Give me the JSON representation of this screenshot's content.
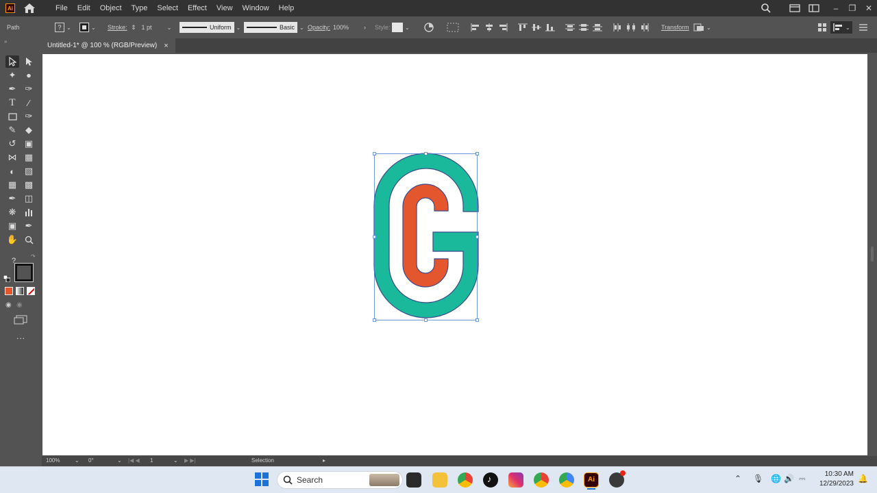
{
  "app": {
    "logo_text": "Ai",
    "menu": [
      "File",
      "Edit",
      "Object",
      "Type",
      "Select",
      "Effect",
      "View",
      "Window",
      "Help"
    ]
  },
  "control_bar": {
    "selection_label": "Path",
    "stroke_label": "Stroke:",
    "stroke_weight": "1 pt",
    "profile_label": "Uniform",
    "brush_label": "Basic",
    "opacity_label": "Opacity:",
    "opacity_value": "100%",
    "style_label": "Style:",
    "transform_label": "Transform"
  },
  "document_tab": {
    "title": "Untitled-1* @ 100 % (RGB/Preview)",
    "close": "×"
  },
  "tools": {
    "fill_unknown": "?",
    "more": "..."
  },
  "artwork": {
    "outer_color": "#1bb99b",
    "inner_color": "#e4572e",
    "stroke_color": "#3b4a8c",
    "selection_color": "#4a7fd4"
  },
  "status_bar": {
    "zoom": "100%",
    "rotation": "0°",
    "artboard_num": "1",
    "tool_name": "Selection"
  },
  "taskbar": {
    "search_placeholder": "Search",
    "time": "10:30 AM",
    "date": "12/29/2023"
  }
}
